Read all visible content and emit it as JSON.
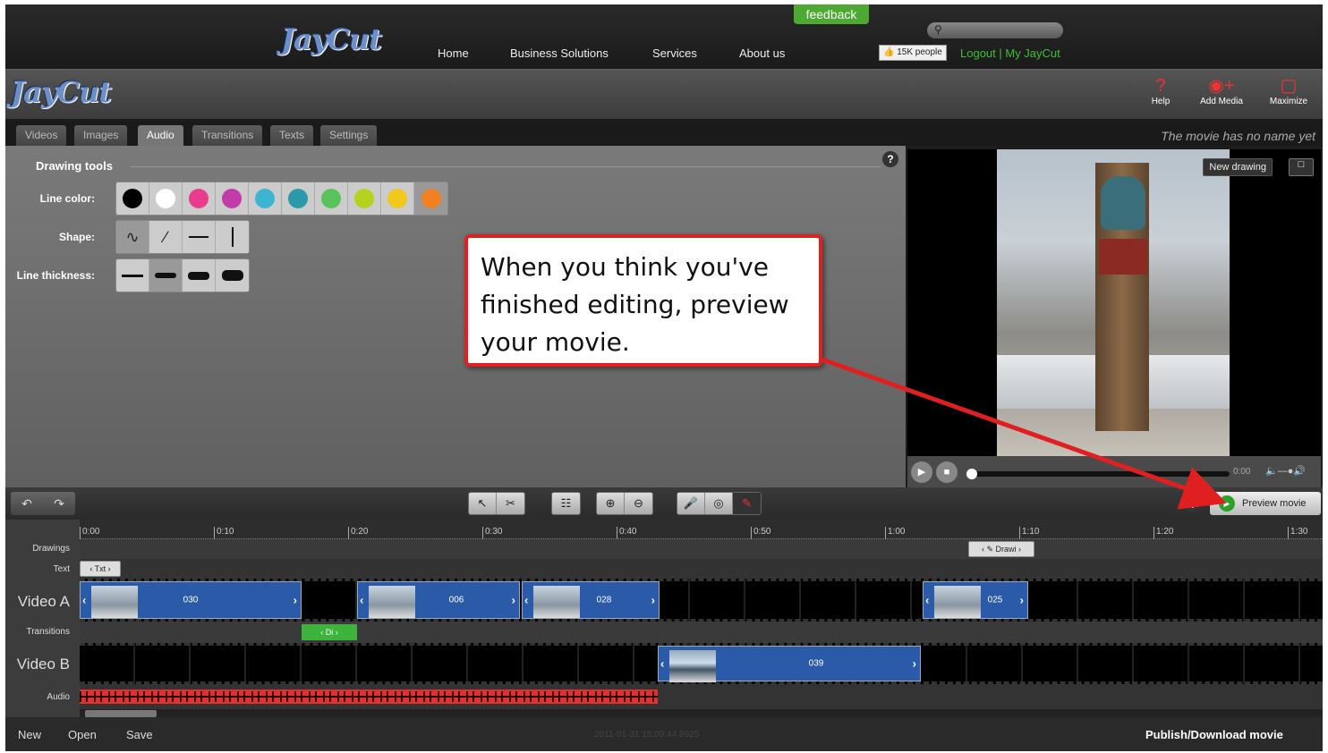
{
  "site": {
    "logo": "JayCut",
    "nav": [
      "Home",
      "Business Solutions",
      "Services",
      "About us"
    ],
    "feedback": "feedback",
    "like_label": "15K people",
    "logout": "Logout | My JayCut"
  },
  "app": {
    "logo": "JayCut",
    "buttons": {
      "help": "Help",
      "add_media": "Add Media",
      "maximize": "Maximize"
    },
    "tabs": [
      "Videos",
      "Images",
      "Audio",
      "Transitions",
      "Texts",
      "Settings"
    ],
    "active_tab": "Audio",
    "movie_title": "The movie has no name yet"
  },
  "panel": {
    "heading": "Drawing tools",
    "line_color_label": "Line color:",
    "shape_label": "Shape:",
    "thickness_label": "Line thickness:",
    "colors": [
      "#000000",
      "#ffffff",
      "#e83c8c",
      "#c23ca8",
      "#3cb4d2",
      "#2a9aaa",
      "#5ac25a",
      "#b4d21e",
      "#f0c81e",
      "#f08020"
    ],
    "selected_color": "#f08020"
  },
  "preview": {
    "new_drawing": "New drawing",
    "time": "0:00"
  },
  "toolbar": {
    "preview_movie": "Preview movie"
  },
  "timeline": {
    "ticks": [
      "0:00",
      "0:10",
      "0:20",
      "0:30",
      "0:40",
      "0:50",
      "1:00",
      "1:10",
      "1:20",
      "1:30"
    ],
    "tracks": {
      "drawings": "Drawings",
      "text": "Text",
      "video_a": "Video A",
      "transitions": "Transitions",
      "video_b": "Video B",
      "audio": "Audio"
    },
    "drawing_clip": "Drawi",
    "text_clip": "Txt",
    "transition_clip": "Di",
    "video_a_clips": [
      "030",
      "006",
      "028",
      "025"
    ],
    "video_b_clips": [
      "039"
    ]
  },
  "footer": {
    "new": "New",
    "open": "Open",
    "save": "Save",
    "stamp": "2011-01-31 15:09:44 8925",
    "publish": "Publish/Download movie"
  },
  "callout": {
    "text": "When you think you've finished editing, preview your movie."
  }
}
